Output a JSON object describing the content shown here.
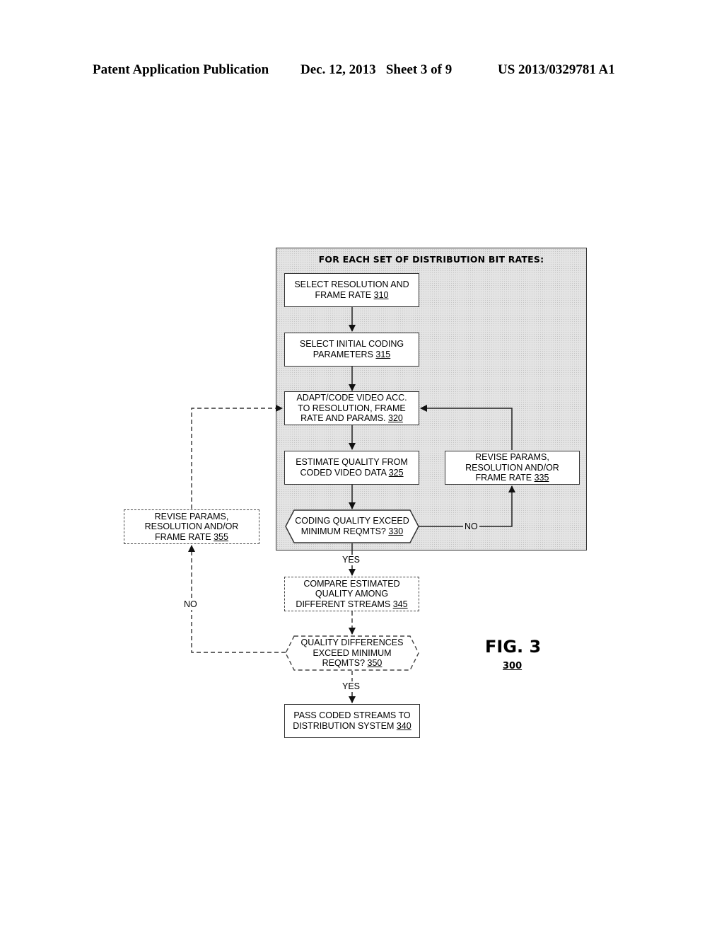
{
  "header": {
    "publication": "Patent Application Publication",
    "date_sheet": "Dec. 12, 2013   Sheet 3 of 9",
    "patent_number": "US 2013/0329781 A1"
  },
  "diagram": {
    "loop_title": "FOR EACH SET OF DISTRIBUTION BIT RATES:",
    "nodes": {
      "n310": {
        "text": "SELECT RESOLUTION AND FRAME RATE",
        "ref": "310",
        "style": "solid",
        "shape": "rect"
      },
      "n315": {
        "text": "SELECT INITIAL CODING PARAMETERS",
        "ref": "315",
        "style": "solid",
        "shape": "rect"
      },
      "n320": {
        "text": "ADAPT/CODE VIDEO ACC. TO RESOLUTION, FRAME RATE AND PARAMS.",
        "ref": "320",
        "style": "solid",
        "shape": "rect"
      },
      "n325": {
        "text": "ESTIMATE QUALITY FROM CODED VIDEO DATA",
        "ref": "325",
        "style": "solid",
        "shape": "rect"
      },
      "n330": {
        "text": "CODING QUALITY EXCEED MINIMUM REQMTS?",
        "ref": "330",
        "style": "solid",
        "shape": "hexagon"
      },
      "n335": {
        "text": "REVISE PARAMS, RESOLUTION AND/OR FRAME RATE",
        "ref": "335",
        "style": "solid",
        "shape": "rect"
      },
      "n345": {
        "text": "COMPARE ESTIMATED QUALITY AMONG DIFFERENT STREAMS",
        "ref": "345",
        "style": "dashed",
        "shape": "rect"
      },
      "n350": {
        "text": "QUALITY DIFFERENCES EXCEED MINIMUM REQMTS?",
        "ref": "350",
        "style": "dashed",
        "shape": "hexagon"
      },
      "n355": {
        "text": "REVISE PARAMS, RESOLUTION AND/OR FRAME RATE",
        "ref": "355",
        "style": "dashed",
        "shape": "rect"
      },
      "n340": {
        "text": "PASS CODED STREAMS TO DISTRIBUTION SYSTEM",
        "ref": "340",
        "style": "solid",
        "shape": "rect"
      }
    },
    "lines": {
      "n310": [
        "SELECT RESOLUTION AND",
        "FRAME RATE "
      ],
      "n315": [
        "SELECT INITIAL CODING",
        "PARAMETERS "
      ],
      "n320": [
        "ADAPT/CODE VIDEO ACC.",
        "TO RESOLUTION, FRAME",
        "RATE AND PARAMS. "
      ],
      "n325": [
        "ESTIMATE QUALITY FROM",
        "CODED VIDEO DATA "
      ],
      "n330": [
        "CODING QUALITY EXCEED",
        "MINIMUM REQMTS? "
      ],
      "n335": [
        "REVISE PARAMS,",
        "RESOLUTION AND/OR",
        "FRAME RATE "
      ],
      "n345": [
        "COMPARE ESTIMATED",
        "QUALITY AMONG",
        "DIFFERENT STREAMS "
      ],
      "n350": [
        "QUALITY DIFFERENCES",
        "EXCEED MINIMUM",
        "REQMTS? "
      ],
      "n355": [
        "REVISE PARAMS,",
        "RESOLUTION AND/OR",
        "FRAME RATE "
      ],
      "n340": [
        "PASS CODED STREAMS TO",
        "DISTRIBUTION SYSTEM "
      ]
    },
    "edges": [
      {
        "from": "310",
        "to": "315",
        "label": ""
      },
      {
        "from": "315",
        "to": "320",
        "label": ""
      },
      {
        "from": "320",
        "to": "325",
        "label": ""
      },
      {
        "from": "325",
        "to": "330",
        "label": ""
      },
      {
        "from": "330",
        "to": "335",
        "label": "NO"
      },
      {
        "from": "335",
        "to": "320",
        "label": ""
      },
      {
        "from": "330",
        "to": "345",
        "label": "YES"
      },
      {
        "from": "345",
        "to": "350",
        "label": ""
      },
      {
        "from": "350",
        "to": "355",
        "label": "NO"
      },
      {
        "from": "355",
        "to": "320",
        "label": ""
      },
      {
        "from": "350",
        "to": "340",
        "label": "YES"
      }
    ],
    "edge_labels": {
      "no_330": "NO",
      "yes_330": "YES",
      "no_350": "NO",
      "yes_350": "YES"
    },
    "figure_label": "FIG. 3",
    "figure_number": "300"
  }
}
